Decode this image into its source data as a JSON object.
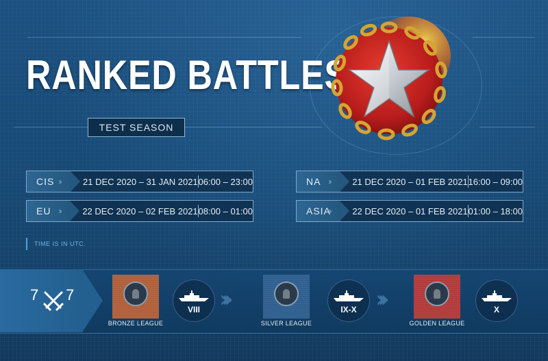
{
  "header": {
    "title": "RANKED BATTLES",
    "season": "TEST SEASON"
  },
  "regions": [
    {
      "tag": "CIS",
      "dates": "21 DEC 2020 – 31 JAN 2021",
      "hours": "06:00 – 23:00"
    },
    {
      "tag": "EU",
      "dates": "22 DEC 2020 – 02 FEB 2021",
      "hours": "08:00 – 01:00"
    },
    {
      "tag": "NA",
      "dates": "21 DEC 2020 – 01 FEB 2021",
      "hours": "16:00 – 09:00"
    },
    {
      "tag": "ASIA",
      "dates": "22 DEC 2020 – 01 FEB 2021",
      "hours": "01:00 – 18:00"
    }
  ],
  "note": "TIME IS IN UTC.",
  "format": {
    "team_a": "7",
    "team_b": "7",
    "icon": "crossed-swords-icon"
  },
  "leagues": [
    {
      "name": "BRONZE LEAGUE",
      "tier": "VIII",
      "color": "#b0603a"
    },
    {
      "name": "SILVER LEAGUE",
      "tier": "IX-X",
      "color": "#2f5f8f"
    },
    {
      "name": "GOLDEN LEAGUE",
      "tier": "X",
      "color": "#b23a3a"
    }
  ],
  "icons": {
    "emblem": "star-chain-emblem-icon",
    "ship": "warship-icon",
    "chevron": "chevron-right-icon"
  },
  "colors": {
    "background": "#17466e",
    "accent": "#4aa6e0",
    "emblem_red": "#c62222",
    "chain_gold": "#d4a531"
  }
}
